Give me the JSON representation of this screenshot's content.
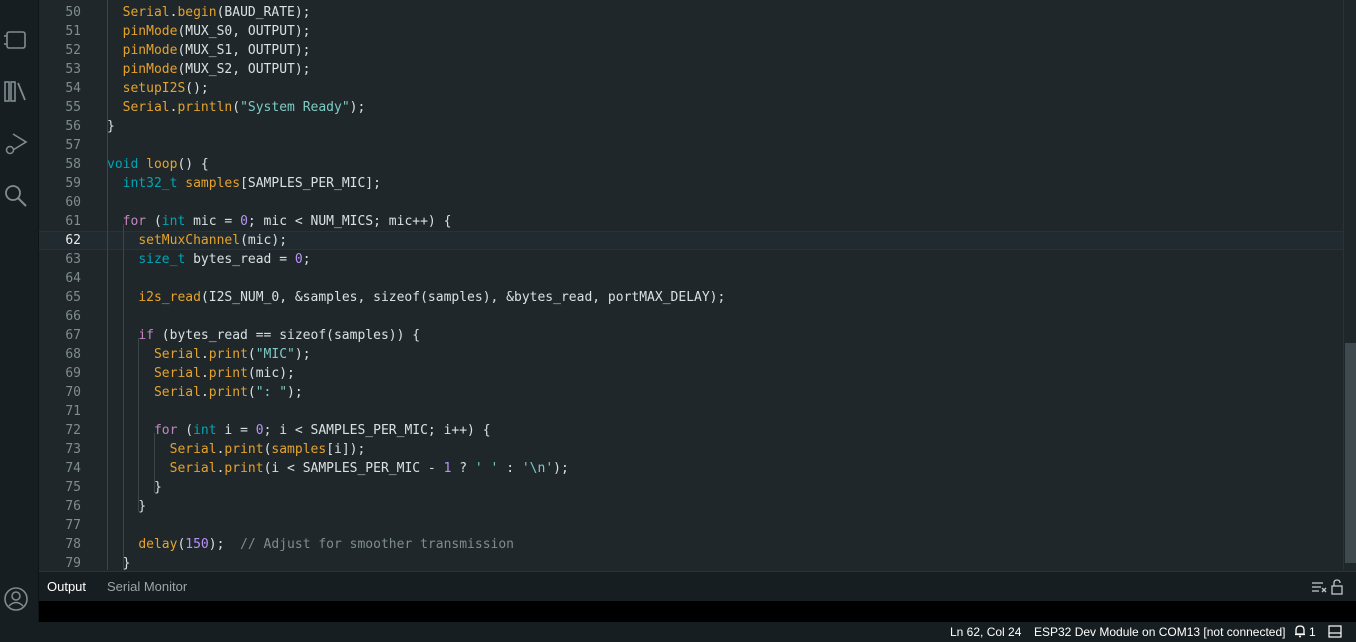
{
  "editor": {
    "current_line": "62",
    "lines": [
      {
        "n": "50",
        "tokens": [
          [
            "  ",
            ""
          ],
          [
            "Serial",
            "fn"
          ],
          [
            ".",
            ""
          ],
          [
            "begin",
            "fn"
          ],
          [
            "(BAUD_RATE);",
            ""
          ]
        ]
      },
      {
        "n": "51",
        "tokens": [
          [
            "  ",
            ""
          ],
          [
            "pinMode",
            "fn"
          ],
          [
            "(MUX_S0, OUTPUT);",
            ""
          ]
        ]
      },
      {
        "n": "52",
        "tokens": [
          [
            "  ",
            ""
          ],
          [
            "pinMode",
            "fn"
          ],
          [
            "(MUX_S1, OUTPUT);",
            ""
          ]
        ]
      },
      {
        "n": "53",
        "tokens": [
          [
            "  ",
            ""
          ],
          [
            "pinMode",
            "fn"
          ],
          [
            "(MUX_S2, OUTPUT);",
            ""
          ]
        ]
      },
      {
        "n": "54",
        "tokens": [
          [
            "  ",
            ""
          ],
          [
            "setupI2S",
            "fn"
          ],
          [
            "();",
            ""
          ]
        ]
      },
      {
        "n": "55",
        "tokens": [
          [
            "  ",
            ""
          ],
          [
            "Serial",
            "fn"
          ],
          [
            ".",
            ""
          ],
          [
            "println",
            "fn"
          ],
          [
            "(",
            ""
          ],
          [
            "\"System Ready\"",
            "st"
          ],
          [
            ");",
            ""
          ]
        ]
      },
      {
        "n": "56",
        "tokens": [
          [
            "}",
            ""
          ]
        ]
      },
      {
        "n": "57",
        "tokens": []
      },
      {
        "n": "58",
        "tokens": [
          [
            "void",
            "ty"
          ],
          [
            " ",
            ""
          ],
          [
            "loop",
            "fn"
          ],
          [
            "() {",
            ""
          ]
        ]
      },
      {
        "n": "59",
        "tokens": [
          [
            "  ",
            ""
          ],
          [
            "int32_t",
            "ty"
          ],
          [
            " ",
            ""
          ],
          [
            "samples",
            "fn"
          ],
          [
            "[SAMPLES_PER_MIC];",
            ""
          ]
        ]
      },
      {
        "n": "60",
        "tokens": []
      },
      {
        "n": "61",
        "tokens": [
          [
            "  ",
            ""
          ],
          [
            "for",
            "kw"
          ],
          [
            " (",
            ""
          ],
          [
            "int",
            "ty"
          ],
          [
            " mic = ",
            ""
          ],
          [
            "0",
            "nm"
          ],
          [
            "; mic < NUM_MICS; mic++) {",
            ""
          ]
        ]
      },
      {
        "n": "62",
        "tokens": [
          [
            "    ",
            ""
          ],
          [
            "setMuxChannel",
            "fn"
          ],
          [
            "(mic);",
            ""
          ]
        ]
      },
      {
        "n": "63",
        "tokens": [
          [
            "    ",
            ""
          ],
          [
            "size_t",
            "ty"
          ],
          [
            " bytes_read = ",
            ""
          ],
          [
            "0",
            "nm"
          ],
          [
            ";",
            ""
          ]
        ]
      },
      {
        "n": "64",
        "tokens": []
      },
      {
        "n": "65",
        "tokens": [
          [
            "    ",
            ""
          ],
          [
            "i2s_read",
            "fn"
          ],
          [
            "(I2S_NUM_0, &samples, sizeof(samples), &bytes_read, portMAX_DELAY);",
            ""
          ]
        ]
      },
      {
        "n": "66",
        "tokens": []
      },
      {
        "n": "67",
        "tokens": [
          [
            "    ",
            ""
          ],
          [
            "if",
            "kw"
          ],
          [
            " (bytes_read == sizeof(samples)) {",
            ""
          ]
        ]
      },
      {
        "n": "68",
        "tokens": [
          [
            "      ",
            ""
          ],
          [
            "Serial",
            "fn"
          ],
          [
            ".",
            ""
          ],
          [
            "print",
            "fn"
          ],
          [
            "(",
            ""
          ],
          [
            "\"MIC\"",
            "st"
          ],
          [
            ");",
            ""
          ]
        ]
      },
      {
        "n": "69",
        "tokens": [
          [
            "      ",
            ""
          ],
          [
            "Serial",
            "fn"
          ],
          [
            ".",
            ""
          ],
          [
            "print",
            "fn"
          ],
          [
            "(mic);",
            ""
          ]
        ]
      },
      {
        "n": "70",
        "tokens": [
          [
            "      ",
            ""
          ],
          [
            "Serial",
            "fn"
          ],
          [
            ".",
            ""
          ],
          [
            "print",
            "fn"
          ],
          [
            "(",
            ""
          ],
          [
            "\": \"",
            "st"
          ],
          [
            ");",
            ""
          ]
        ]
      },
      {
        "n": "71",
        "tokens": []
      },
      {
        "n": "72",
        "tokens": [
          [
            "      ",
            ""
          ],
          [
            "for",
            "kw"
          ],
          [
            " (",
            ""
          ],
          [
            "int",
            "ty"
          ],
          [
            " i = ",
            ""
          ],
          [
            "0",
            "nm"
          ],
          [
            "; i < SAMPLES_PER_MIC; i++) {",
            ""
          ]
        ]
      },
      {
        "n": "73",
        "tokens": [
          [
            "        ",
            ""
          ],
          [
            "Serial",
            "fn"
          ],
          [
            ".",
            ""
          ],
          [
            "print",
            "fn"
          ],
          [
            "(",
            ""
          ],
          [
            "samples",
            "fn"
          ],
          [
            "[i]);",
            ""
          ]
        ]
      },
      {
        "n": "74",
        "tokens": [
          [
            "        ",
            ""
          ],
          [
            "Serial",
            "fn"
          ],
          [
            ".",
            ""
          ],
          [
            "print",
            "fn"
          ],
          [
            "(i < SAMPLES_PER_MIC - ",
            ""
          ],
          [
            "1",
            "nm"
          ],
          [
            " ? ",
            ""
          ],
          [
            "' '",
            "st"
          ],
          [
            " : ",
            ""
          ],
          [
            "'\\n'",
            "st"
          ],
          [
            ");",
            ""
          ]
        ]
      },
      {
        "n": "75",
        "tokens": [
          [
            "      }",
            ""
          ]
        ]
      },
      {
        "n": "76",
        "tokens": [
          [
            "    }",
            ""
          ]
        ]
      },
      {
        "n": "77",
        "tokens": []
      },
      {
        "n": "78",
        "tokens": [
          [
            "    ",
            ""
          ],
          [
            "delay",
            "fn"
          ],
          [
            "(",
            ""
          ],
          [
            "150",
            "nm"
          ],
          [
            ");  ",
            ""
          ],
          [
            "// Adjust for smoother transmission",
            "cm"
          ]
        ]
      },
      {
        "n": "79",
        "tokens": [
          [
            "  }",
            ""
          ]
        ]
      }
    ]
  },
  "panel": {
    "tabs": [
      {
        "label": "Output"
      },
      {
        "label": "Serial Monitor"
      }
    ]
  },
  "status": {
    "cursor": "Ln 62, Col 24",
    "board": "ESP32 Dev Module on COM13 [not connected]",
    "notifications": "1"
  },
  "icons": {
    "activity": [
      "sketchbook-icon",
      "library-manager-icon",
      "debug-icon",
      "search-icon",
      "account-icon"
    ],
    "panel": [
      "clear-output-icon",
      "lock-scroll-icon"
    ],
    "status": [
      "notification-bell-icon",
      "toggle-panel-icon"
    ]
  }
}
